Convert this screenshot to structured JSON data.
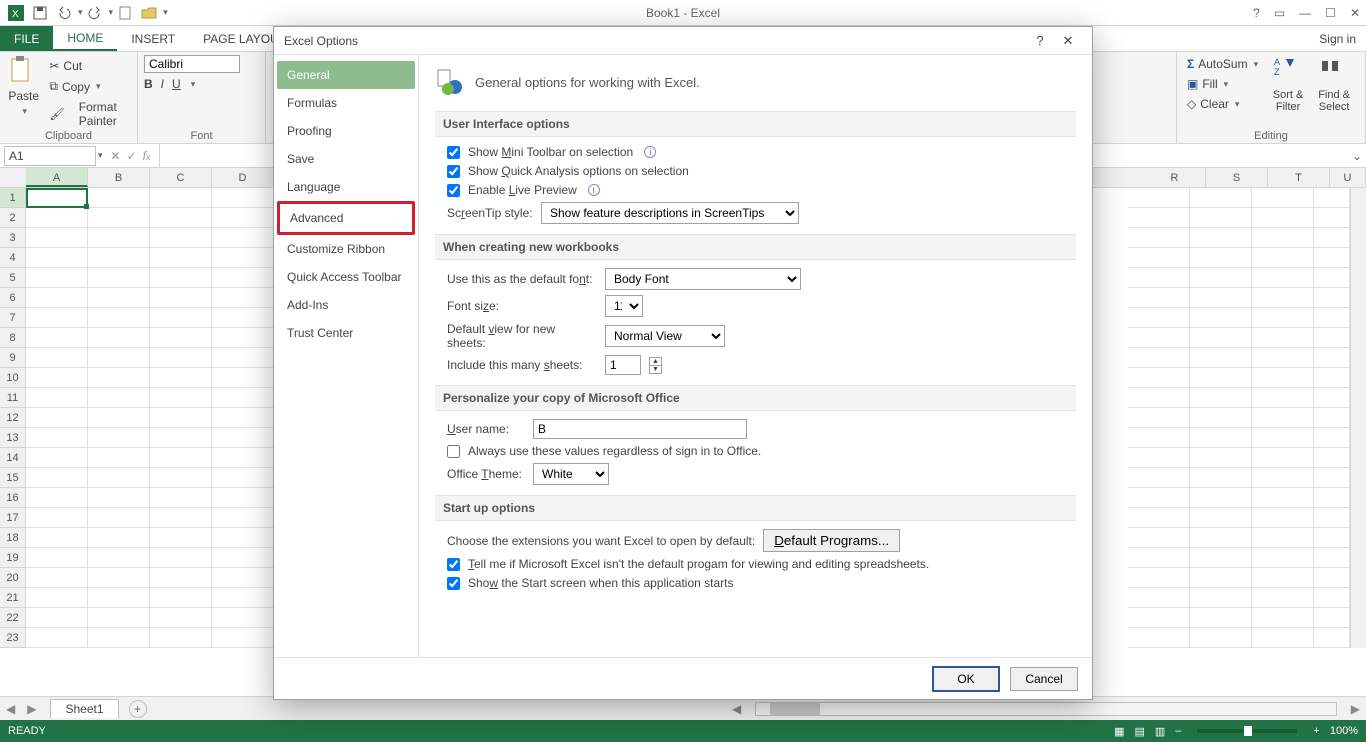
{
  "qat": {
    "title": "Book1 - Excel",
    "signin": "Sign in"
  },
  "tabs": {
    "file": "FILE",
    "home": "HOME",
    "insert": "INSERT",
    "pagelayout": "PAGE LAYOU"
  },
  "ribbon": {
    "clipboard": {
      "paste": "Paste",
      "cut": "Cut",
      "copy": "Copy",
      "format_painter": "Format Painter",
      "label": "Clipboard"
    },
    "font": {
      "name": "Calibri",
      "label": "Font"
    },
    "editing": {
      "autosum": "AutoSum",
      "fill": "Fill",
      "clear": "Clear",
      "sortfilter": "Sort &\nFilter",
      "findselect": "Find &\nSelect",
      "label": "Editing"
    }
  },
  "namebox": "A1",
  "columns": [
    "A",
    "B",
    "C",
    "D",
    "R",
    "S",
    "T",
    "U"
  ],
  "rows_left": [
    "1",
    "2",
    "3",
    "4",
    "5",
    "6",
    "7",
    "8",
    "9",
    "10",
    "11",
    "12",
    "13",
    "14",
    "15",
    "16",
    "17",
    "18",
    "19",
    "20",
    "21",
    "22",
    "23"
  ],
  "sheet_tab": "Sheet1",
  "status": {
    "ready": "READY",
    "zoom": "100%"
  },
  "dialog": {
    "title": "Excel Options",
    "nav": {
      "general": "General",
      "formulas": "Formulas",
      "proofing": "Proofing",
      "save": "Save",
      "language": "Language",
      "advanced": "Advanced",
      "customize_ribbon": "Customize Ribbon",
      "qat": "Quick Access Toolbar",
      "addins": "Add-Ins",
      "trust": "Trust Center"
    },
    "header": "General options for working with Excel.",
    "ui_section": "User Interface options",
    "mini_toolbar": "Show Mini Toolbar on selection",
    "quick_analysis": "Show Quick Analysis options on selection",
    "live_preview": "Enable Live Preview",
    "screentip_label": "ScreenTip style:",
    "screentip_value": "Show feature descriptions in ScreenTips",
    "wb_section": "When creating new workbooks",
    "default_font_label": "Use this as the default font:",
    "default_font_value": "Body Font",
    "font_size_label": "Font size:",
    "font_size_value": "11",
    "default_view_label": "Default view for new sheets:",
    "default_view_value": "Normal View",
    "sheets_label": "Include this many sheets:",
    "sheets_value": "1",
    "personalize_section": "Personalize your copy of Microsoft Office",
    "username_label": "User name:",
    "username_value": "B",
    "always_use": "Always use these values regardless of sign in to Office.",
    "theme_label": "Office Theme:",
    "theme_value": "White",
    "startup_section": "Start up options",
    "extensions_label": "Choose the extensions you want Excel to open by default:",
    "default_programs_btn": "Default Programs...",
    "tell_default": "Tell me if Microsoft Excel isn't the default progam for viewing and editing spreadsheets.",
    "show_start": "Show the Start screen when this application starts",
    "ok": "OK",
    "cancel": "Cancel"
  }
}
